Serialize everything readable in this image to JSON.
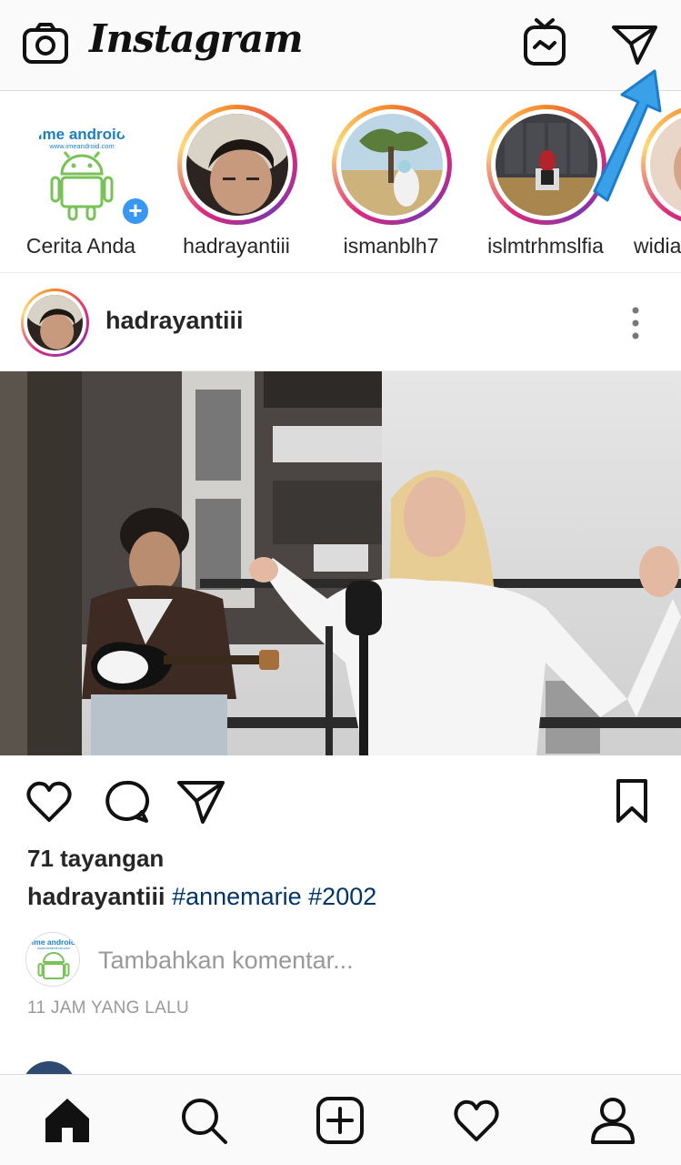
{
  "app": {
    "brand": "Instagram"
  },
  "header": {
    "camera_icon": "camera-icon",
    "igtv_icon": "igtv-icon",
    "direct_icon": "paper-plane-icon"
  },
  "stories": [
    {
      "label": "Cerita Anda",
      "own": true,
      "logo_text": "ime androio",
      "logo_sub": "www.imeandroid.com"
    },
    {
      "label": "hadrayantiii"
    },
    {
      "label": "ismanblh7"
    },
    {
      "label": "islmtrhmslfia"
    },
    {
      "label": "widia"
    }
  ],
  "post": {
    "username": "hadrayantiii",
    "views": "71 tayangan",
    "caption_user": "hadrayantiii",
    "hashtags": "#annemarie #2002",
    "comment_placeholder": "Tambahkan komentar...",
    "time": "11 JAM YANG LALU"
  },
  "colors": {
    "link": "#003569",
    "accent_blue": "#3897f0",
    "overlay_arrow": "#3aa0e8",
    "android_green": "#78c257"
  },
  "bottom_nav": [
    "home-icon",
    "search-icon",
    "new-post-icon",
    "activity-heart-icon",
    "profile-icon"
  ]
}
